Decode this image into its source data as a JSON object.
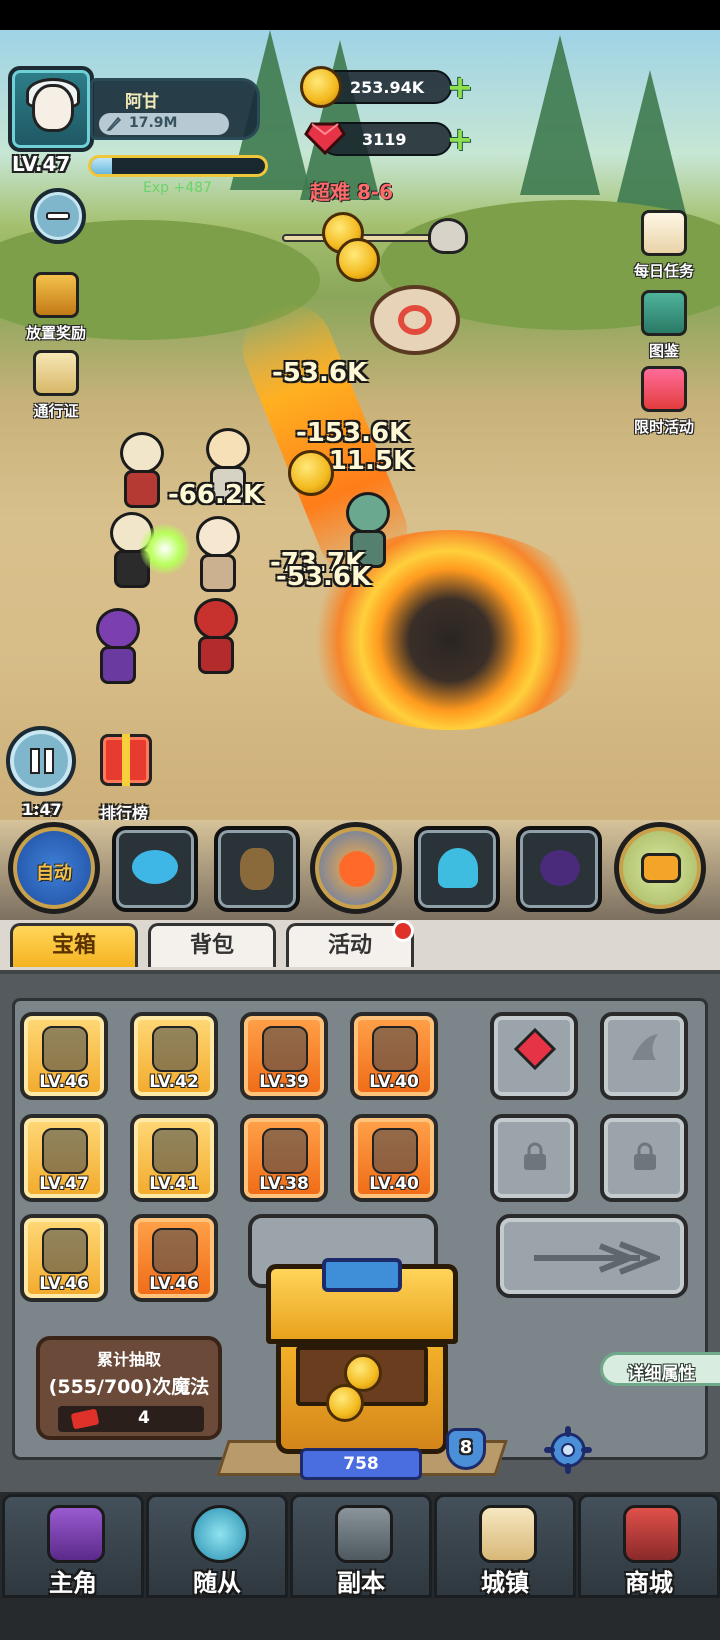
{
  "player": {
    "name": "阿甘",
    "power": "17.9M",
    "level": "LV.47",
    "exp_gain": "Exp +487",
    "exp_fraction": 0.12
  },
  "currency": {
    "gold": "253.94K",
    "gems": "3119"
  },
  "stage": "超难 8-6",
  "side_left": {
    "idle_reward": "放置奖励",
    "pass": "通行证"
  },
  "side_right": {
    "daily_tasks": "每日任务",
    "codex": "图鉴",
    "limited_event": "限时活动"
  },
  "damage_numbers": [
    "-53.6K",
    "-153.6K",
    "-11.5K",
    "-66.2K",
    "-73.7K",
    "-53.6K"
  ],
  "battle": {
    "timer": "1:47",
    "ranking": "排行榜"
  },
  "skills": {
    "auto": "自动",
    "icons": [
      "ice-shard-icon",
      "grenade-icon",
      "fire-orb-icon",
      "ghost-icon",
      "shadow-bird-icon",
      "next-arrow-icon"
    ]
  },
  "tabs": {
    "chest": "宝箱",
    "bag": "背包",
    "event": "活动"
  },
  "equipment": [
    {
      "icon": "mace-icon",
      "level": "LV.46",
      "rarity": "gold"
    },
    {
      "icon": "helmet-icon",
      "level": "LV.42",
      "rarity": "gold"
    },
    {
      "icon": "armor-icon",
      "level": "LV.39",
      "rarity": "orange"
    },
    {
      "icon": "necklace-icon",
      "level": "LV.40",
      "rarity": "orange"
    },
    {
      "icon": "ring-icon",
      "level": "LV.47",
      "rarity": "gold"
    },
    {
      "icon": "spear-icon",
      "level": "LV.41",
      "rarity": "gold"
    },
    {
      "icon": "crossbow-icon",
      "level": "LV.38",
      "rarity": "orange"
    },
    {
      "icon": "shield-icon",
      "level": "LV.40",
      "rarity": "orange"
    },
    {
      "icon": "boots-icon",
      "level": "LV.46",
      "rarity": "gold"
    },
    {
      "icon": "gauntlet-icon",
      "level": "LV.46",
      "rarity": "orange"
    }
  ],
  "draw": {
    "title": "累计抽取",
    "progress": "(555/700)次魔法",
    "tickets": "4"
  },
  "chest": {
    "count": "758",
    "level": "8"
  },
  "detail_button": "详细属性",
  "nav": {
    "hero": "主角",
    "follower": "随从",
    "dungeon": "副本",
    "town": "城镇",
    "shop": "商城"
  }
}
